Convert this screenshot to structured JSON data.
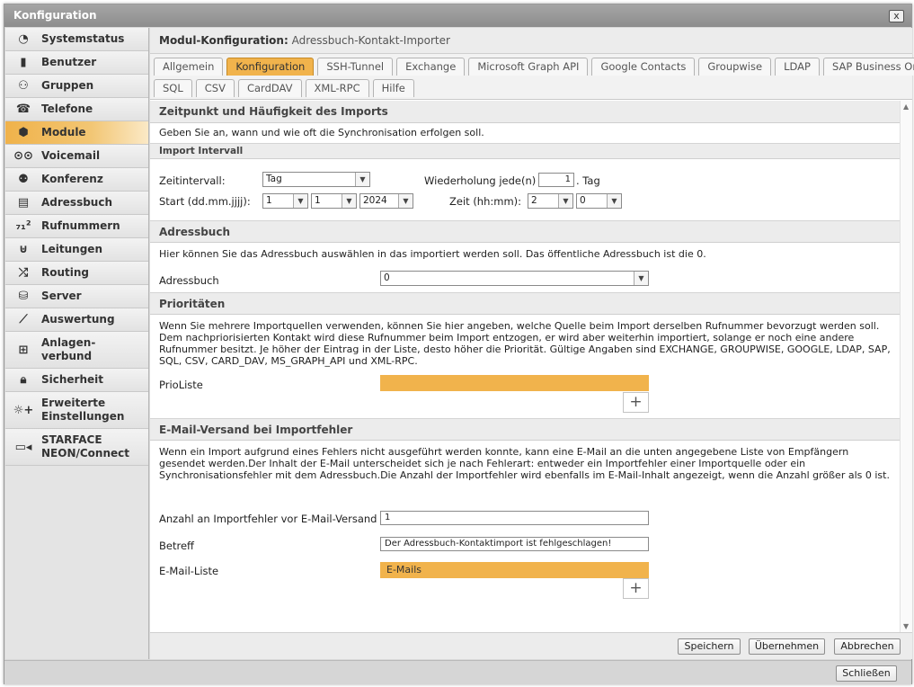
{
  "window": {
    "title": "Konfiguration",
    "close_label": "x"
  },
  "sidebar": {
    "items": [
      {
        "label": "Systemstatus",
        "icon": "clock-icon"
      },
      {
        "label": "Benutzer",
        "icon": "user-icon"
      },
      {
        "label": "Gruppen",
        "icon": "group-icon"
      },
      {
        "label": "Telefone",
        "icon": "phone-icon"
      },
      {
        "label": "Module",
        "icon": "cube-icon"
      },
      {
        "label": "Voicemail",
        "icon": "voicemail-icon"
      },
      {
        "label": "Konferenz",
        "icon": "conference-icon"
      },
      {
        "label": "Adressbuch",
        "icon": "addressbook-icon"
      },
      {
        "label": "Rufnummern",
        "icon": "numbers-icon"
      },
      {
        "label": "Leitungen",
        "icon": "lines-icon"
      },
      {
        "label": "Routing",
        "icon": "routing-icon"
      },
      {
        "label": "Server",
        "icon": "server-icon"
      },
      {
        "label": "Auswertung",
        "icon": "chart-icon"
      },
      {
        "label_line1": "Anlagen-",
        "label_line2": "verbund",
        "icon": "network-icon"
      },
      {
        "label": "Sicherheit",
        "icon": "lock-icon"
      },
      {
        "label_line1": "Erweiterte",
        "label_line2": "Einstellungen",
        "icon": "settings-icon"
      },
      {
        "label_line1": "STARFACE",
        "label_line2": "NEON/Connect",
        "icon": "camera-icon"
      }
    ]
  },
  "header": {
    "key": "Modul-Konfiguration:",
    "value": "Adressbuch-Kontakt-Importer"
  },
  "tabs": {
    "row1": [
      "Allgemein",
      "Konfiguration",
      "SSH-Tunnel",
      "Exchange",
      "Microsoft Graph API",
      "Google Contacts",
      "Groupwise",
      "LDAP",
      "SAP Business One"
    ],
    "row2": [
      "SQL",
      "CSV",
      "CardDAV",
      "XML-RPC",
      "Hilfe"
    ]
  },
  "sec_zeit": {
    "title": "Zeitpunkt und Häufigkeit des Imports",
    "desc": "Geben Sie an, wann und wie oft die Synchronisation erfolgen soll.",
    "subhead": "Import Intervall",
    "zeitintervall_label": "Zeitintervall:",
    "zeitintervall_value": "Tag",
    "wiederholung_label": "Wiederholung jede(n)",
    "wiederholung_value": "1",
    "wiederholung_unit": ". Tag",
    "start_label": "Start (dd.mm.jjjj):",
    "start_day": "1",
    "start_month": "1",
    "start_year": "2024",
    "zeit_label": "Zeit (hh:mm):",
    "zeit_h": "2",
    "zeit_m": "0"
  },
  "sec_adressbuch": {
    "title": "Adressbuch",
    "desc": "Hier können Sie das Adressbuch auswählen in das importiert werden soll. Das öffentliche Adressbuch ist die 0.",
    "label": "Adressbuch",
    "value": "0"
  },
  "sec_prio": {
    "title": "Prioritäten",
    "desc": "Wenn Sie mehrere Importquellen verwenden, können Sie hier angeben, welche Quelle beim Import derselben Rufnummer bevorzugt werden soll. Dem nachpriorisierten Kontakt wird diese Rufnummer beim Import entzogen, er wird aber weiterhin importiert, solange er noch eine andere Rufnummer besitzt. Je höher der Eintrag in der Liste, desto höher die Priorität. Gültige Angaben sind EXCHANGE, GROUPWISE, GOOGLE, LDAP, SAP, SQL, CSV, CARD_DAV, MS_GRAPH_API und XML-RPC.",
    "label": "PrioListe",
    "add_symbol": "+"
  },
  "sec_mail": {
    "title": "E-Mail-Versand bei Importfehler",
    "desc": "Wenn ein Import aufgrund eines Fehlers nicht ausgeführt werden konnte, kann eine E-Mail an die unten angegebene Liste von Empfängern gesendet werden.Der Inhalt der E-Mail unterscheidet sich je nach Fehlerart: entweder ein Importfehler einer Importquelle oder ein Synchronisationsfehler mit dem Adressbuch.Die Anzahl der Importfehler wird ebenfalls im E-Mail-Inhalt angezeigt, wenn die Anzahl größer als 0 ist.",
    "anzahl_label": "Anzahl an Importfehler vor E-Mail-Versand",
    "anzahl_value": "1",
    "betreff_label": "Betreff",
    "betreff_value": "Der Adressbuch-Kontaktimport ist fehlgeschlagen!",
    "liste_label": "E-Mail-Liste",
    "liste_header": "E-Mails",
    "add_symbol": "+"
  },
  "buttons": {
    "save": "Speichern",
    "apply": "Übernehmen",
    "cancel": "Abbrechen",
    "close": "Schließen"
  },
  "colors": {
    "accent": "#f1b34c",
    "active_nav": "#f0b24a"
  }
}
